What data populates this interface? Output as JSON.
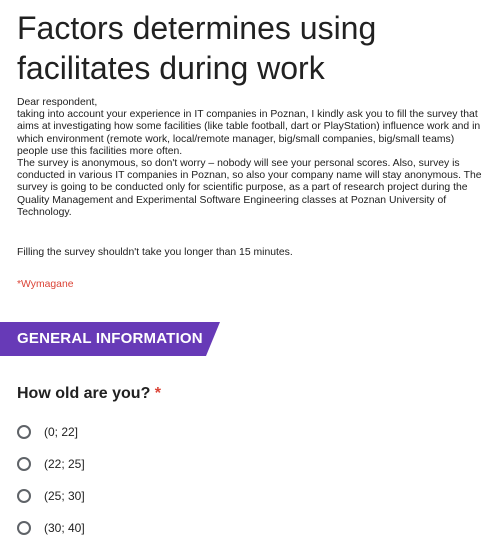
{
  "form": {
    "title": "Factors determines using facilitates during work",
    "description_lines": [
      "Dear respondent,",
      "taking into account your experience in IT companies in Poznan, I kindly ask you to fill the survey that aims at investigating how some facilities (like table football, dart or PlayStation) influence work and in which environment (remote work, local/remote manager, big/small companies, big/small teams) people use this facilities more often.",
      "The survey is anonymous, so don't worry – nobody will see your personal scores. Also, survey is conducted in various IT companies in Poznan, so also your company name will stay anonymous. The survey is going to be conducted only for scientific purpose, as a part of research project during the Quality Management and Experimental Software Engineering classes at Poznan University of Technology."
    ],
    "time_note": "Filling the survey shouldn't take you longer than 15 minutes.",
    "required_note": "*Wymagane"
  },
  "section": {
    "title": "GENERAL INFORMATION",
    "color": "#673ab7"
  },
  "question": {
    "title": "How old are you?",
    "required_marker": "*",
    "options": [
      "(0; 22]",
      "(22; 25]",
      "(25; 30]",
      "(30; 40]"
    ]
  }
}
